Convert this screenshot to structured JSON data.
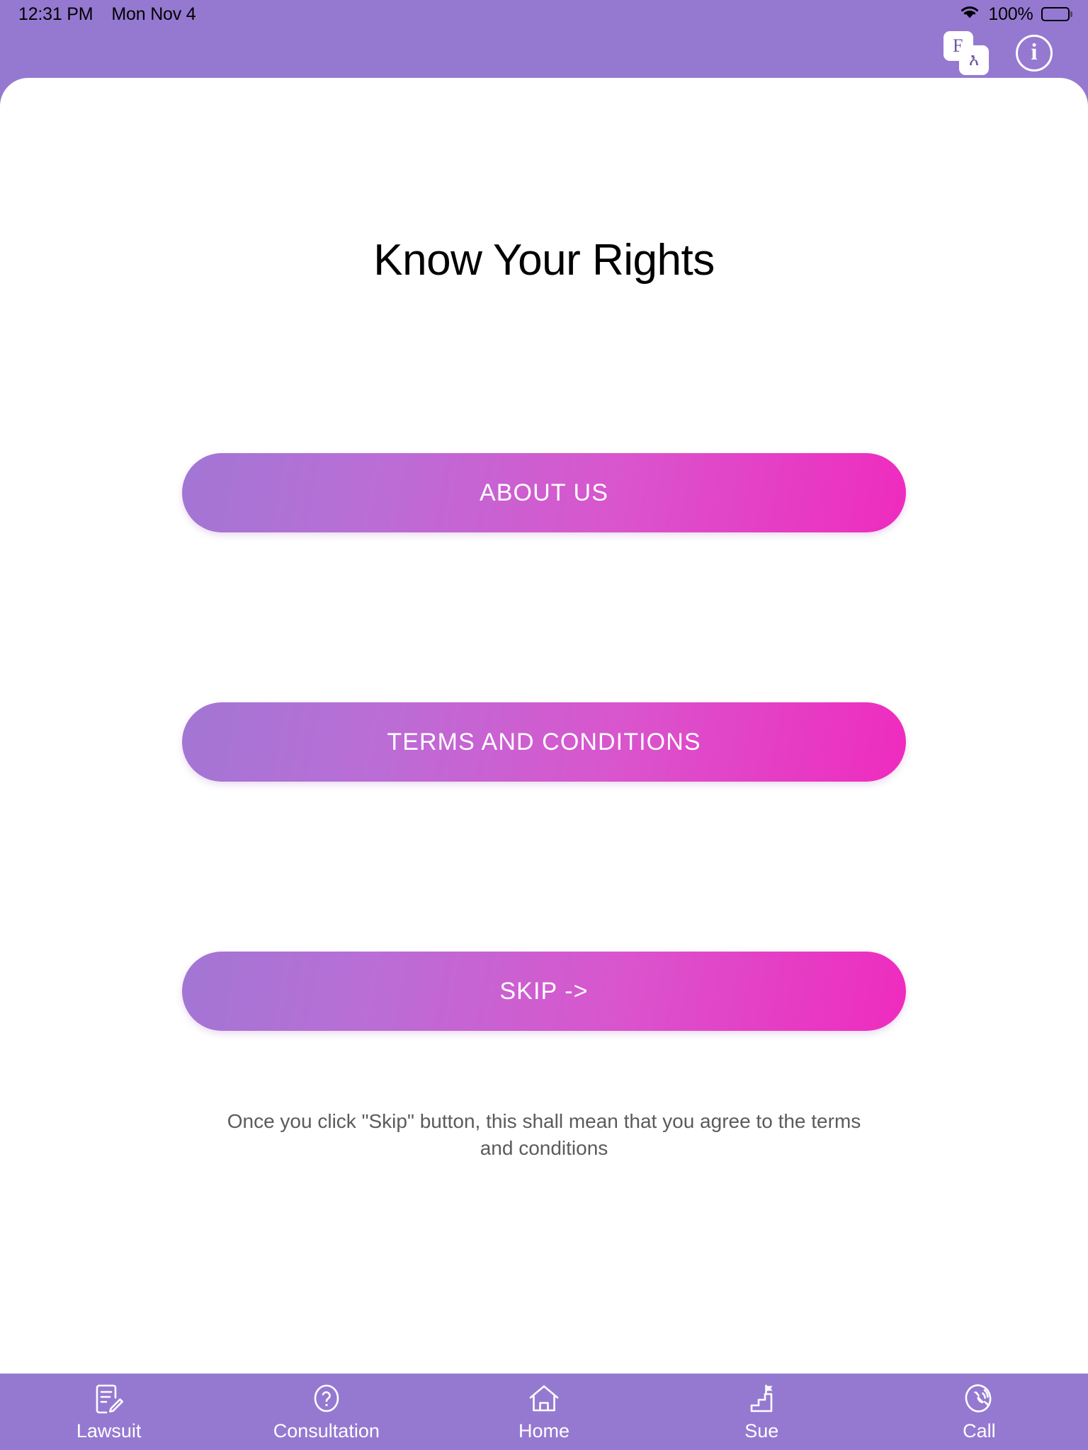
{
  "status_bar": {
    "time": "12:31 PM",
    "date": "Mon Nov 4",
    "battery_percent": "100%",
    "wifi_icon": "wifi-icon",
    "battery_icon": "battery-full-icon"
  },
  "header": {
    "language_toggle": {
      "icon": "language-toggle-icon",
      "primary_letter": "E",
      "secondary_letter": "እ"
    },
    "info_button": {
      "icon": "info-icon",
      "glyph": "i"
    }
  },
  "main": {
    "title": "Know Your Rights",
    "buttons": [
      {
        "label": "ABOUT US",
        "name": "about-us-button"
      },
      {
        "label": "TERMS AND CONDITIONS",
        "name": "terms-and-conditions-button"
      },
      {
        "label": "SKIP ->",
        "name": "skip-button"
      }
    ],
    "disclaimer": "Once you click \"Skip\" button, this shall mean that you agree to the terms and conditions"
  },
  "bottom_nav": {
    "items": [
      {
        "label": "Lawsuit",
        "icon": "document-pencil-icon"
      },
      {
        "label": "Consultation",
        "icon": "question-circle-icon"
      },
      {
        "label": "Home",
        "icon": "home-icon"
      },
      {
        "label": "Sue",
        "icon": "stairs-flag-icon"
      },
      {
        "label": "Call",
        "icon": "phone-waves-icon"
      }
    ]
  },
  "colors": {
    "header_purple": "#9579d1",
    "gradient_start": "#a276d4",
    "gradient_end": "#ef2bbf",
    "card_background": "#ffffff",
    "title_color": "#000000",
    "disclaimer_color": "#5b5b5b"
  }
}
